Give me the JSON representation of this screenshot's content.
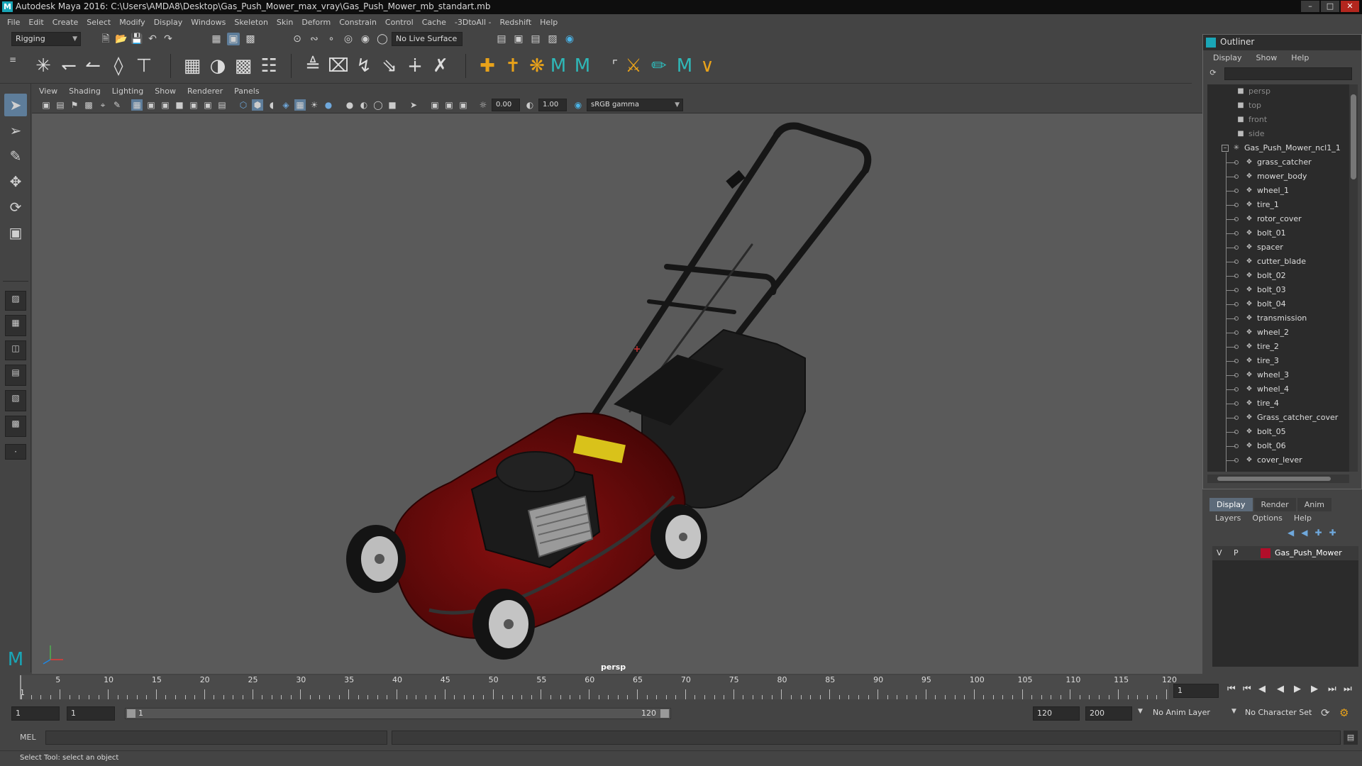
{
  "window": {
    "title": "Autodesk Maya 2016: C:\\Users\\AMDA8\\Desktop\\Gas_Push_Mower_max_vray\\Gas_Push_Mower_mb_standart.mb",
    "logo": "M"
  },
  "menubar": [
    "File",
    "Edit",
    "Create",
    "Select",
    "Modify",
    "Display",
    "Windows",
    "Skeleton",
    "Skin",
    "Deform",
    "Constrain",
    "Control",
    "Cache",
    "-3DtoAll -",
    "Redshift",
    "Help"
  ],
  "statusline": {
    "mode_menu": "Rigging",
    "live_surface": "No Live Surface"
  },
  "viewport": {
    "menus": [
      "View",
      "Shading",
      "Lighting",
      "Show",
      "Renderer",
      "Panels"
    ],
    "exposure": "0.00",
    "gamma": "1.00",
    "color_space": "sRGB gamma",
    "camera_label": "persp"
  },
  "outliner": {
    "title": "Outliner",
    "menus": [
      "Display",
      "Show",
      "Help"
    ],
    "cameras": [
      "persp",
      "top",
      "front",
      "side"
    ],
    "root": "Gas_Push_Mower_ncl1_1",
    "children": [
      "grass_catcher",
      "mower_body",
      "wheel_1",
      "tire_1",
      "rotor_cover",
      "bolt_01",
      "spacer",
      "cutter_blade",
      "bolt_02",
      "bolt_03",
      "bolt_04",
      "transmission",
      "wheel_2",
      "tire_2",
      "tire_3",
      "wheel_3",
      "wheel_4",
      "tire_4",
      "Grass_catcher_cover",
      "bolt_05",
      "bolt_06",
      "cover_lever"
    ]
  },
  "layer_editor": {
    "tabs": [
      "Display",
      "Render",
      "Anim"
    ],
    "active_tab": "Display",
    "menus": [
      "Layers",
      "Options",
      "Help"
    ],
    "layer": {
      "v": "V",
      "p": "P",
      "name": "Gas_Push_Mower",
      "color": "#b10e2a"
    }
  },
  "timeline": {
    "ticks": [
      "5",
      "10",
      "15",
      "20",
      "25",
      "30",
      "35",
      "40",
      "45",
      "50",
      "55",
      "60",
      "65",
      "70",
      "75",
      "80",
      "85",
      "90",
      "95",
      "100",
      "105",
      "110",
      "115",
      "120"
    ],
    "start_label": "1",
    "current_frame": "1"
  },
  "range": {
    "start": "1",
    "playback_start": "1",
    "slider_start": "1",
    "slider_end": "120",
    "playback_end": "120",
    "end": "200",
    "anim_layer": "No Anim Layer",
    "character_set": "No Character Set"
  },
  "command_line": {
    "label": "MEL"
  },
  "help_line": {
    "text": "Select Tool: select an object"
  },
  "colors": {
    "accent": "#5e7d9a",
    "maya_teal": "#1aa6b7",
    "layer_red": "#b10e2a"
  }
}
